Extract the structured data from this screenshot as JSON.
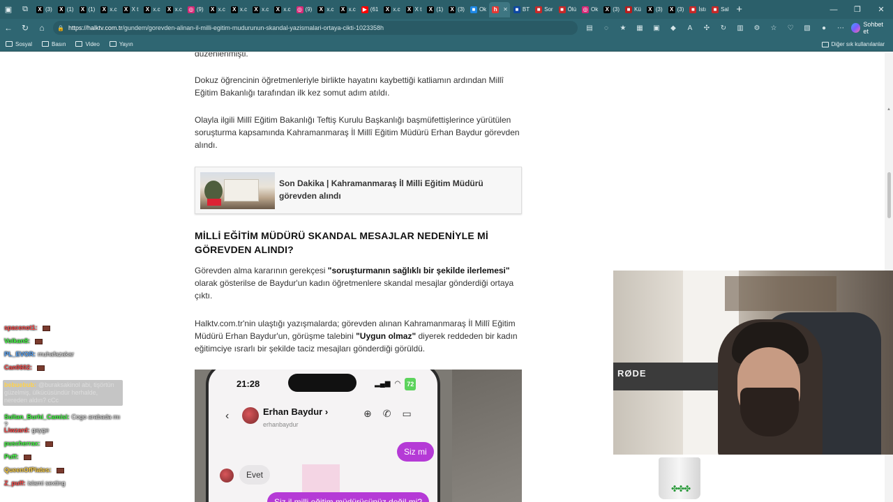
{
  "browser": {
    "tabs": [
      {
        "label": "(3)",
        "icon": "x-icon",
        "color": "#000000"
      },
      {
        "label": "(1)",
        "icon": "x-icon",
        "color": "#000000"
      },
      {
        "label": "(1)",
        "icon": "x-icon",
        "color": "#000000"
      },
      {
        "label": "x.c",
        "icon": "x-icon",
        "color": "#000000"
      },
      {
        "label": "X t",
        "icon": "x-icon",
        "color": "#000000"
      },
      {
        "label": "x.c",
        "icon": "x-icon",
        "color": "#000000"
      },
      {
        "label": "x.c",
        "icon": "x-icon",
        "color": "#000000"
      },
      {
        "label": "(9)",
        "icon": "instagram-icon",
        "color": "#d62976"
      },
      {
        "label": "x.c",
        "icon": "x-icon",
        "color": "#000000"
      },
      {
        "label": "x.c",
        "icon": "x-icon",
        "color": "#000000"
      },
      {
        "label": "x.c",
        "icon": "x-icon",
        "color": "#000000"
      },
      {
        "label": "x.c",
        "icon": "x-icon",
        "color": "#000000"
      },
      {
        "label": "(9)",
        "icon": "instagram-icon",
        "color": "#d62976"
      },
      {
        "label": "x.c",
        "icon": "x-icon",
        "color": "#000000"
      },
      {
        "label": "x.c",
        "icon": "x-icon",
        "color": "#000000"
      },
      {
        "label": "(61",
        "icon": "youtube-icon",
        "color": "#ff0000"
      },
      {
        "label": "x.c",
        "icon": "x-icon",
        "color": "#000000"
      },
      {
        "label": "X t",
        "icon": "x-icon",
        "color": "#000000"
      },
      {
        "label": "(1)",
        "icon": "x-icon",
        "color": "#000000"
      },
      {
        "label": "(3)",
        "icon": "x-icon",
        "color": "#000000"
      },
      {
        "label": "Ok",
        "icon": "news-icon",
        "color": "#1e88e5"
      },
      {
        "label": "",
        "icon": "halktv-icon",
        "color": "#e53935",
        "active": true
      },
      {
        "label": "BT",
        "icon": "news-icon",
        "color": "#0d47a1"
      },
      {
        "label": "Sor",
        "icon": "news-icon",
        "color": "#c62828"
      },
      {
        "label": "Ölü",
        "icon": "news-icon",
        "color": "#c62828"
      },
      {
        "label": "Ok",
        "icon": "instagram-icon",
        "color": "#d62976"
      },
      {
        "label": "(3)",
        "icon": "x-icon",
        "color": "#000000"
      },
      {
        "label": "Kü",
        "icon": "news-icon",
        "color": "#b71c1c"
      },
      {
        "label": "(3)",
        "icon": "x-icon",
        "color": "#000000"
      },
      {
        "label": "(3)",
        "icon": "x-icon",
        "color": "#000000"
      },
      {
        "label": "İstı",
        "icon": "news-icon",
        "color": "#c62828"
      },
      {
        "label": "Sal",
        "icon": "news-icon",
        "color": "#c62828"
      }
    ],
    "url_host": "https://halktv.com.tr",
    "url_path": "/gundem/gorevden-alinan-il-milli-egitim-mudurunun-skandal-yazismalari-ortaya-cikti-1023358h",
    "copilot_label": "Sohbet et",
    "favorites": [
      "Sosyal",
      "Basın",
      "Video",
      "Yayın"
    ],
    "favorites_other": "Diğer sık kullanılanlar"
  },
  "article": {
    "top_fragment": "düzenlenmişti.",
    "p1": "Dokuz öğrencinin öğretmenleriyle birlikte hayatını kaybettiği katliamın ardından Millî Eğitim Bakanlığı tarafından ilk kez somut adım atıldı.",
    "p2": "Olayla ilgili Millî Eğitim Bakanlığı Teftiş Kurulu Başkanlığı başmüfettişlerince yürütülen soruşturma kapsamında Kahramanmaraş İl Millî Eğitim Müdürü Erhan Baydur görevden alındı.",
    "related_title": "Son Dakika | Kahramanmaraş İl Milli Eğitim Müdürü görevden alındı",
    "heading": "MİLLİ EĞİTİM MÜDÜRÜ SKANDAL MESAJLAR NEDENİYLE Mİ GÖREVDEN ALINDI?",
    "p3_pre": "Görevden alma kararının gerekçesi ",
    "p3_bold": "\"soruşturmanın sağlıklı bir şekilde ilerlemesi\"",
    "p3_post": " olarak gösterilse de Baydur'un kadın öğretmenlere skandal mesajlar gönderdiği ortaya çıktı.",
    "p4_pre": "Halktv.com.tr'nin ulaştığı yazışmalarda; görevden alınan Kahramanmaraş İl Millî Eğitim Müdürü Erhan Baydur'un, görüşme talebini ",
    "p4_bold": "\"Uygun olmaz\"",
    "p4_post": " diyerek reddeden bir kadın eğitimciye ısrarlı bir şekilde taciz mesajları gönderdiği görüldü."
  },
  "phone": {
    "time": "21:28",
    "battery": "72",
    "contact_name": "Erhan Baydur",
    "contact_handle": "erhanbaydur",
    "msg1": "Siz mi",
    "msg2": "Evet",
    "msg3": "Siz il milli eğitim müdürüsünüz değil mi?"
  },
  "chat": {
    "messages": [
      {
        "user": "spacenot1:",
        "text": "",
        "color": "#ff4d4d"
      },
      {
        "user": "Volkan8:",
        "text": "",
        "color": "#44ff44"
      },
      {
        "user": "PL_EVOR:",
        "text": "muhafazakar",
        "color": "#5aa9ff"
      },
      {
        "user": "Can0602:",
        "text": "",
        "color": "#ff4d4d"
      },
      {
        "user": "bebuebub:",
        "text": "@buraksakinol abi, tişörtün güzelmiş, ülkücüsündür herhalde, nereden aldın? cCc",
        "color": "#ffd24a",
        "highlight": true
      },
      {
        "user": "Sultan_Burhi_Camisi:",
        "text": "Cogo arabada mı ?",
        "color": "#44ff44"
      },
      {
        "user": "Liwzard:",
        "text": "gayge",
        "color": "#ff4d4d"
      },
      {
        "user": "puscherrax:",
        "text": "",
        "color": "#44ff44"
      },
      {
        "user": "Puff:",
        "text": "",
        "color": "#44ff44"
      },
      {
        "user": "QueenOfPlates:",
        "text": "",
        "color": "#ffd24a"
      },
      {
        "user": "Z_puff:",
        "text": "islami sexting",
        "color": "#ff4d4d"
      }
    ]
  },
  "webcam": {
    "mic_brand": "RØDE"
  }
}
